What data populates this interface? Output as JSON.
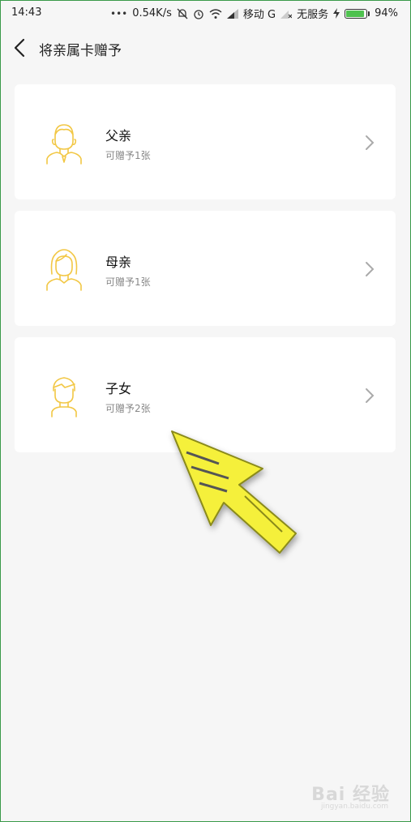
{
  "status_bar": {
    "time": "14:43",
    "dots": "•••",
    "speed": "0.54K/s",
    "carrier": "移动 G",
    "no_service": "无服务",
    "battery_percent": "94%",
    "battery_level": 0.94,
    "icons": [
      "mute-bell-icon",
      "alarm-icon",
      "wifi-icon",
      "signal-icon",
      "signal-x-icon",
      "charging-icon",
      "battery-icon"
    ]
  },
  "header": {
    "title": "将亲属卡赠予"
  },
  "cards": [
    {
      "name": "父亲",
      "sub": "可赠予1张",
      "icon": "father-avatar-icon"
    },
    {
      "name": "母亲",
      "sub": "可赠予1张",
      "icon": "mother-avatar-icon"
    },
    {
      "name": "子女",
      "sub": "可赠予2张",
      "icon": "child-avatar-icon"
    }
  ],
  "watermark": {
    "brand": "Bai 经验",
    "url": "jingyan.baidu.com"
  },
  "colors": {
    "accent": "#f2c744",
    "arrow": "#f5f03a",
    "background": "#f6f6f6"
  }
}
